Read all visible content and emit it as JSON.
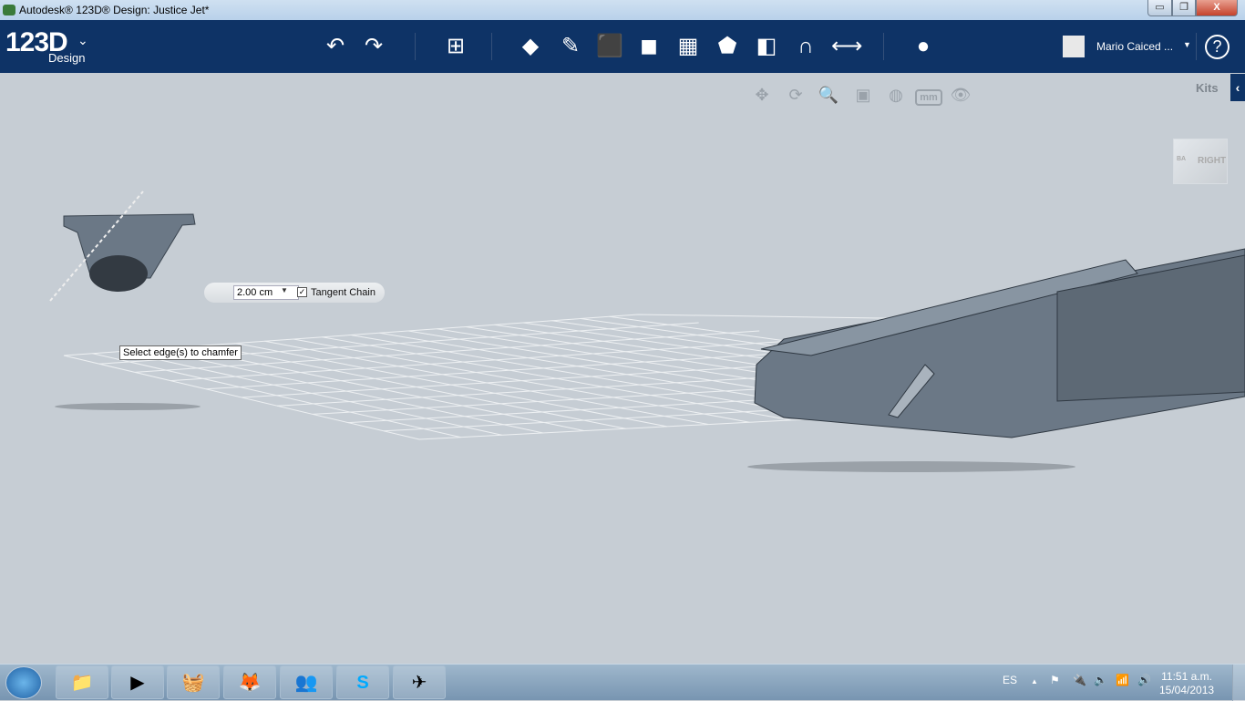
{
  "window": {
    "title": "Autodesk® 123D® Design: Justice Jet*",
    "minimize": "▭",
    "maximize": "❐",
    "close": "X"
  },
  "toolbar": {
    "logo": "123D",
    "logo_sub": "Design",
    "logo_menu": "⌄",
    "tools": [
      {
        "name": "undo",
        "glyph": "↶"
      },
      {
        "name": "redo",
        "glyph": "↷"
      },
      {
        "name": "transform",
        "glyph": "⊞"
      },
      {
        "name": "primitives",
        "glyph": "◆"
      },
      {
        "name": "sketch",
        "glyph": "✎"
      },
      {
        "name": "construct",
        "glyph": "⬛"
      },
      {
        "name": "modify",
        "glyph": "◼"
      },
      {
        "name": "pattern",
        "glyph": "▦"
      },
      {
        "name": "grouping",
        "glyph": "⬟"
      },
      {
        "name": "combine",
        "glyph": "◧"
      },
      {
        "name": "snap",
        "glyph": "∩"
      },
      {
        "name": "measure",
        "glyph": "⟷"
      },
      {
        "name": "material",
        "glyph": "●"
      }
    ],
    "user": "Mario Caiced ...",
    "help": "?"
  },
  "nav": {
    "tools": [
      {
        "name": "pan",
        "glyph": "✥"
      },
      {
        "name": "orbit",
        "glyph": "⟳"
      },
      {
        "name": "zoom",
        "glyph": "🔍"
      },
      {
        "name": "fit",
        "glyph": "▣"
      },
      {
        "name": "view-mode",
        "glyph": "◍"
      }
    ],
    "units": "mm",
    "visibility": "👁"
  },
  "kits": {
    "label": "Kits",
    "toggle": "‹"
  },
  "viewcube": {
    "face": "RIGHT",
    "back": "BA"
  },
  "chamfer": {
    "value": "2.00 cm",
    "dropdown": "▼",
    "tangent_chain_checked": true,
    "check": "✓",
    "tangent_chain_label": "Tangent Chain"
  },
  "tooltip": "Select edge(s) to chamfer",
  "taskbar": {
    "apps": [
      "📁",
      "▶",
      "🧺",
      "🦊",
      "👥",
      "S",
      "✈"
    ],
    "lang": "ES",
    "tray_arrow": "▲",
    "tray_icons": [
      "⚑",
      "🔌",
      "🔈",
      "📶",
      "🔊"
    ],
    "time": "11:51 a.m.",
    "date": "15/04/2013"
  },
  "colors": {
    "toolbar": "#0e3366",
    "viewport": "#c6cdd4",
    "model": "#6b7886"
  }
}
